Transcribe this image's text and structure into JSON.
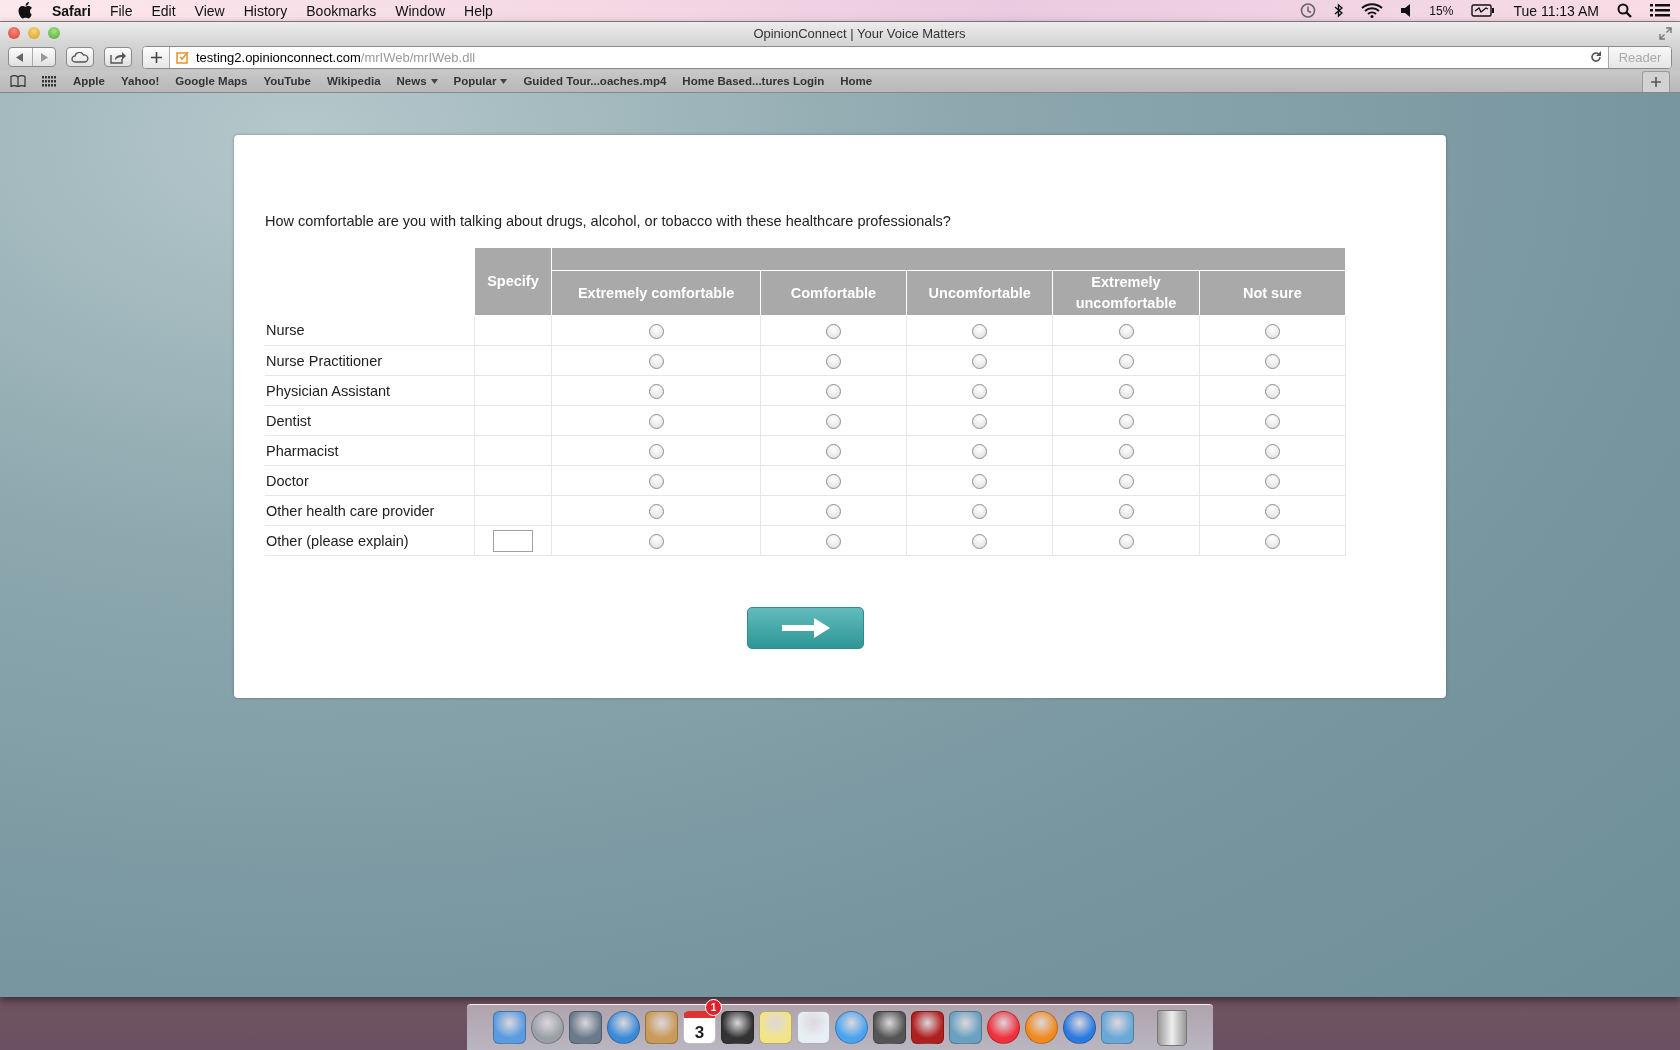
{
  "menubar": {
    "app": "Safari",
    "menus": [
      "File",
      "Edit",
      "View",
      "History",
      "Bookmarks",
      "Window",
      "Help"
    ],
    "battery": "15%",
    "clock": "Tue 11:13 AM"
  },
  "window": {
    "title": "OpinionConnect | Your Voice Matters"
  },
  "address": {
    "host": "testing2.opinionconnect.com",
    "path": "/mrIWeb/mrIWeb.dll",
    "reader": "Reader"
  },
  "bookmarks": [
    {
      "label": "Apple",
      "menu": false
    },
    {
      "label": "Yahoo!",
      "menu": false
    },
    {
      "label": "Google Maps",
      "menu": false
    },
    {
      "label": "YouTube",
      "menu": false
    },
    {
      "label": "Wikipedia",
      "menu": false
    },
    {
      "label": "News",
      "menu": true
    },
    {
      "label": "Popular",
      "menu": true
    },
    {
      "label": "Guided Tour...oaches.mp4",
      "menu": false
    },
    {
      "label": "Home Based...tures Login",
      "menu": false
    },
    {
      "label": "Home",
      "menu": false
    }
  ],
  "survey": {
    "question": "How comfortable are you with talking about drugs, alcohol, or tobacco with these healthcare professionals?",
    "specify_heading": "Specify",
    "columns": [
      "Extremely comfortable",
      "Comfortable",
      "Uncomfortable",
      "Extremely uncomfortable",
      "Not sure"
    ],
    "rows": [
      {
        "label": "Nurse",
        "specify_field": false,
        "options": [
          {
            "selected": false
          },
          {
            "selected": false
          },
          {
            "selected": false
          },
          {
            "selected": false
          },
          {
            "selected": false
          }
        ]
      },
      {
        "label": "Nurse Practitioner",
        "specify_field": false,
        "options": [
          {
            "selected": false
          },
          {
            "selected": false
          },
          {
            "selected": false
          },
          {
            "selected": false
          },
          {
            "selected": false
          }
        ]
      },
      {
        "label": "Physician Assistant",
        "specify_field": false,
        "options": [
          {
            "selected": false
          },
          {
            "selected": false
          },
          {
            "selected": false
          },
          {
            "selected": false
          },
          {
            "selected": false
          }
        ]
      },
      {
        "label": "Dentist",
        "specify_field": false,
        "options": [
          {
            "selected": false
          },
          {
            "selected": false
          },
          {
            "selected": false
          },
          {
            "selected": false
          },
          {
            "selected": false
          }
        ]
      },
      {
        "label": "Pharmacist",
        "specify_field": false,
        "options": [
          {
            "selected": false
          },
          {
            "selected": false
          },
          {
            "selected": false
          },
          {
            "selected": false
          },
          {
            "selected": false
          }
        ]
      },
      {
        "label": "Doctor",
        "specify_field": false,
        "options": [
          {
            "selected": false
          },
          {
            "selected": false
          },
          {
            "selected": false
          },
          {
            "selected": false
          },
          {
            "selected": false
          }
        ]
      },
      {
        "label": "Other health care provider",
        "specify_field": false,
        "options": [
          {
            "selected": false
          },
          {
            "selected": false
          },
          {
            "selected": false
          },
          {
            "selected": false
          },
          {
            "selected": false
          }
        ]
      },
      {
        "label": "Other (please explain)",
        "specify_field": true,
        "options": [
          {
            "selected": false
          },
          {
            "selected": false
          },
          {
            "selected": false
          },
          {
            "selected": false
          },
          {
            "selected": false
          }
        ]
      }
    ]
  },
  "dock": {
    "calendar_day": "3",
    "calendar_badge": "1"
  }
}
